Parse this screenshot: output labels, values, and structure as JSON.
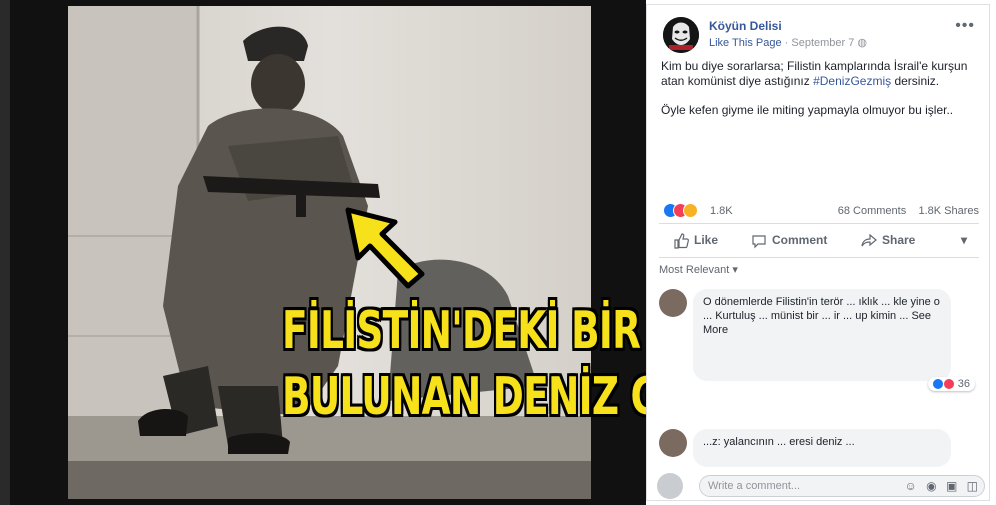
{
  "caption": {
    "line1": "FİLİSTİN'DEKİ BİR KAMPTA",
    "line2": "BULUNAN DENİZ GEZMİŞ..."
  },
  "post": {
    "page_name": "Köyün Delisi",
    "like_page": "Like This Page",
    "date": "September 7",
    "text_part1": "Kim bu diye sorarlarsa; Filistin kamplarında İsrail'e kurşun atan komünist diye astığınız ",
    "hashtag": "#DenizGezmiş",
    "text_part2": " dersiniz.",
    "text_para2": "Öyle kefen giyme ile miting yapmayla olmuyor bu işler..",
    "reaction_count": "1.8K",
    "comments": "68 Comments",
    "shares": "1.8K Shares"
  },
  "actions": {
    "like": "Like",
    "comment": "Comment",
    "share": "Share"
  },
  "most_relevant": "Most Relevant ▾",
  "comments": [
    {
      "text": "O dönemlerde Filistin'in terör ... ıklık ... kle yine o ... Kurtuluş ... münist bir ... ir ... up kimin ... See More",
      "reaction_count": "36"
    },
    {
      "text": "...z: yalancının ... eresi deniz ..."
    }
  ],
  "write_comment": {
    "placeholder": "Write a comment...",
    "icons": [
      "emoji-icon",
      "camera-icon",
      "gif-icon",
      "sticker-icon"
    ]
  },
  "colors": {
    "caption": "#f7e11a",
    "link": "#365899",
    "like": "#1877f2",
    "love": "#f33e58"
  }
}
